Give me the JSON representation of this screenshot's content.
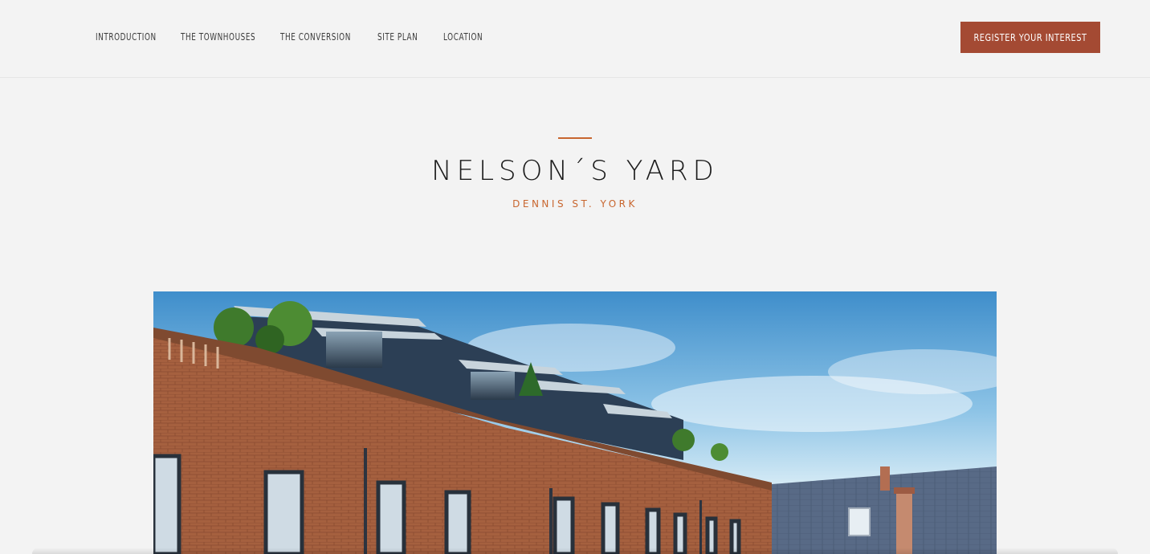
{
  "nav": {
    "items": [
      {
        "label": "INTRODUCTION"
      },
      {
        "label": "THE TOWNHOUSES"
      },
      {
        "label": "THE CONVERSION"
      },
      {
        "label": "SITE PLAN"
      },
      {
        "label": "LOCATION"
      }
    ],
    "cta_label": "REGISTER YOUR INTEREST"
  },
  "hero": {
    "title": "NELSON´S YARD",
    "subtitle": "DENNIS ST. YORK"
  },
  "colors": {
    "accent": "#c8662f",
    "cta": "#a44a33",
    "background": "#f3f3f3"
  }
}
